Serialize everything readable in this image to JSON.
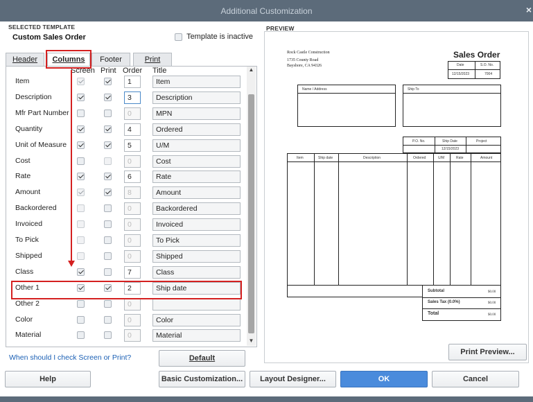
{
  "window": {
    "title": "Additional Customization",
    "close": "×"
  },
  "selected_template": {
    "section_label": "SELECTED TEMPLATE",
    "name": "Custom Sales Order",
    "inactive_label": "Template is inactive",
    "inactive_checked": false
  },
  "preview": {
    "section_label": "PREVIEW"
  },
  "tabs": [
    {
      "label": "Header",
      "active": false
    },
    {
      "label": "Columns",
      "active": true
    },
    {
      "label": "Footer",
      "active": false
    },
    {
      "label": "Print",
      "active": false
    }
  ],
  "columns_header": {
    "screen": "Screen",
    "print": "Print",
    "order": "Order",
    "title": "Title"
  },
  "rows": [
    {
      "label": "Item",
      "screen": true,
      "screen_disabled": true,
      "print": true,
      "print_disabled": false,
      "order": "1",
      "title": "Item"
    },
    {
      "label": "Description",
      "screen": true,
      "screen_disabled": false,
      "print": true,
      "print_disabled": false,
      "order": "3",
      "title": "Description"
    },
    {
      "label": "Mfr Part Number",
      "screen": false,
      "screen_disabled": false,
      "print": false,
      "print_disabled": false,
      "order": "0",
      "title": "MPN"
    },
    {
      "label": "Quantity",
      "screen": true,
      "screen_disabled": false,
      "print": true,
      "print_disabled": false,
      "order": "4",
      "title": "Ordered"
    },
    {
      "label": "Unit of Measure",
      "screen": true,
      "screen_disabled": false,
      "print": true,
      "print_disabled": false,
      "order": "5",
      "title": "U/M"
    },
    {
      "label": "Cost",
      "screen": false,
      "screen_disabled": false,
      "print": false,
      "print_disabled": true,
      "order": "0",
      "title": "Cost"
    },
    {
      "label": "Rate",
      "screen": true,
      "screen_disabled": false,
      "print": true,
      "print_disabled": false,
      "order": "6",
      "title": "Rate"
    },
    {
      "label": "Amount",
      "screen": true,
      "screen_disabled": true,
      "print": true,
      "print_disabled": false,
      "order": "8",
      "title": "Amount"
    },
    {
      "label": "Backordered",
      "screen": false,
      "screen_disabled": true,
      "print": false,
      "print_disabled": false,
      "order": "0",
      "title": "Backordered"
    },
    {
      "label": "Invoiced",
      "screen": false,
      "screen_disabled": true,
      "print": false,
      "print_disabled": false,
      "order": "0",
      "title": "Invoiced"
    },
    {
      "label": "To Pick",
      "screen": false,
      "screen_disabled": true,
      "print": false,
      "print_disabled": false,
      "order": "0",
      "title": "To Pick"
    },
    {
      "label": "Shipped",
      "screen": false,
      "screen_disabled": true,
      "print": false,
      "print_disabled": false,
      "order": "0",
      "title": "Shipped"
    },
    {
      "label": "Class",
      "screen": true,
      "screen_disabled": false,
      "print": false,
      "print_disabled": false,
      "order": "7",
      "title": "Class"
    },
    {
      "label": "Other 1",
      "screen": true,
      "screen_disabled": false,
      "print": true,
      "print_disabled": false,
      "order": "2",
      "title": "Ship date"
    },
    {
      "label": "Other 2",
      "screen": false,
      "screen_disabled": false,
      "print": false,
      "print_disabled": false,
      "order": "0",
      "title": ""
    },
    {
      "label": "Color",
      "screen": false,
      "screen_disabled": false,
      "print": false,
      "print_disabled": false,
      "order": "0",
      "title": "Color"
    },
    {
      "label": "Material",
      "screen": false,
      "screen_disabled": false,
      "print": false,
      "print_disabled": false,
      "order": "0",
      "title": "Material"
    }
  ],
  "help_link": "When should I check Screen or Print?",
  "buttons": {
    "default": "Default",
    "print_preview": "Print Preview...",
    "help": "Help",
    "basic_customization": "Basic Customization...",
    "layout_designer": "Layout Designer...",
    "ok": "OK",
    "cancel": "Cancel"
  },
  "doc": {
    "company": "Rock Castle Construction",
    "address1": "1735 County Road",
    "address2": "Bayshore, CA 94326",
    "title": "Sales Order",
    "date_label": "Date",
    "so_label": "S.O. No.",
    "date": "12/15/2023",
    "so_no": "7004",
    "name_address": "Name / Address",
    "ship_to": "Ship To",
    "po_label": "P.O. No.",
    "ship_date_label": "Ship Date",
    "project_label": "Project",
    "ship_date": "12/15/2023",
    "line_cols": [
      "Item",
      "Ship date",
      "Description",
      "Ordered",
      "U/M",
      "Rate",
      "Amount"
    ],
    "subtotal_label": "Subtotal",
    "subtotal": "$0.00",
    "tax_label": "Sales Tax  (0.0%)",
    "tax": "$0.00",
    "total_label": "Total",
    "total": "$0.00"
  },
  "colors": {
    "annotation": "#d42020",
    "titlebar": "#5c6b7a",
    "ok_button": "#4a8bdc",
    "link": "#1a5fb4"
  }
}
